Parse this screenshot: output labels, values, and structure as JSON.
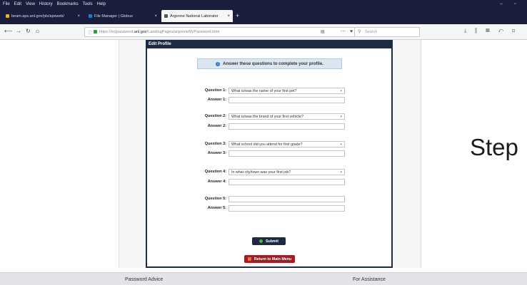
{
  "menubar": {
    "items": [
      "File",
      "Edit",
      "View",
      "History",
      "Bookmarks",
      "Tools",
      "Help"
    ]
  },
  "tabs": [
    {
      "title": "beam.aps.anl.gov/pls/apsweb/",
      "fav_color": "#e0b040"
    },
    {
      "title": "File Manager | Globus",
      "fav_color": "#2b78c6"
    },
    {
      "title": "Argonne National Laborator",
      "fav_color": "#555555"
    }
  ],
  "nav": {
    "url_prefix": "https://mypassword.",
    "url_domain": "anl.gov",
    "url_path": "/LandingPages/argonneMyPassword.html",
    "search_placeholder": "Search"
  },
  "form": {
    "header": "Edit Profile",
    "notice": "Answer these questions to complete your profile.",
    "questions": [
      {
        "q_label": "Question 1:",
        "q_value": "What is/was the name of your first pet?",
        "a_label": "Answer 1:"
      },
      {
        "q_label": "Question 2:",
        "q_value": "What is/was the brand of your first vehicle?",
        "a_label": "Answer 2:"
      },
      {
        "q_label": "Question 3:",
        "q_value": "What school did you attend for first grade?",
        "a_label": "Answer 3:"
      },
      {
        "q_label": "Question 4:",
        "q_value": "In what city/town was your first job?",
        "a_label": "Answer 4:"
      },
      {
        "q_label": "Question 5:",
        "q_value": "",
        "a_label": "Answer 5:"
      }
    ],
    "submit_label": "Submit",
    "return_label": "Return to Main Menu"
  },
  "footer": {
    "left": "Password Advice",
    "right": "For Assistance"
  },
  "overlay_text": "Step",
  "colors": {
    "frame": "#1c2a44",
    "return_button": "#9b1f24",
    "notice_bg": "#dbe6f0"
  }
}
